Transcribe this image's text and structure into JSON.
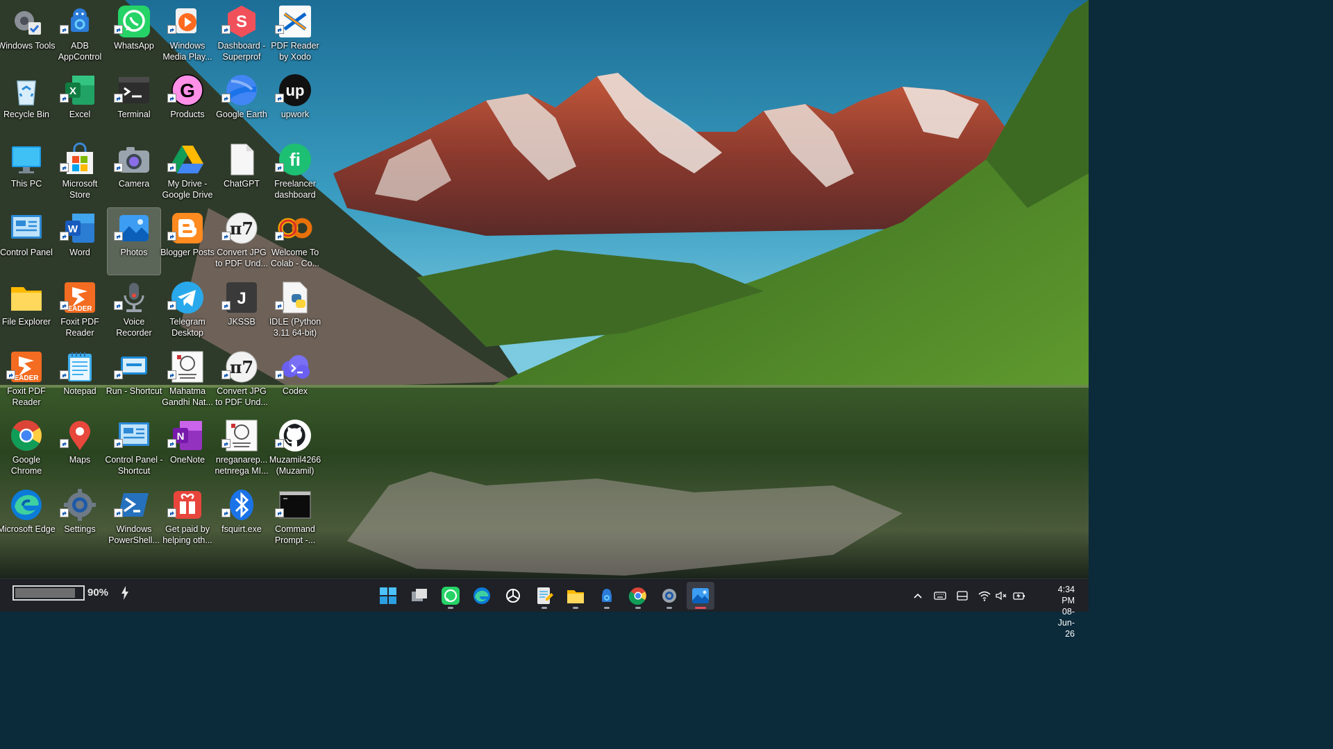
{
  "desktop": {
    "icons": [
      {
        "label": "Windows Tools",
        "icon": "gear-check-icon",
        "shortcut": false
      },
      {
        "label": "ADB AppControl",
        "icon": "android-robot-icon",
        "shortcut": true
      },
      {
        "label": "WhatsApp",
        "icon": "whatsapp-icon",
        "shortcut": true
      },
      {
        "label": "Windows Media Play...",
        "icon": "media-player-icon",
        "shortcut": true
      },
      {
        "label": "Dashboard - Superprof",
        "icon": "superprof-icon",
        "shortcut": true
      },
      {
        "label": "PDF Reader by Xodo",
        "icon": "xodo-icon",
        "shortcut": true
      },
      {
        "label": "Recycle Bin",
        "icon": "recycle-bin-icon",
        "shortcut": false
      },
      {
        "label": "Excel",
        "icon": "excel-icon",
        "shortcut": true
      },
      {
        "label": "Terminal",
        "icon": "terminal-icon",
        "shortcut": true
      },
      {
        "label": "Products",
        "icon": "gumroad-icon",
        "shortcut": true
      },
      {
        "label": "Google Earth",
        "icon": "google-earth-icon",
        "shortcut": true
      },
      {
        "label": "upwork",
        "icon": "upwork-icon",
        "shortcut": true
      },
      {
        "label": "This PC",
        "icon": "monitor-icon",
        "shortcut": false
      },
      {
        "label": "Microsoft Store",
        "icon": "store-bag-icon",
        "shortcut": true
      },
      {
        "label": "Camera",
        "icon": "camera-icon",
        "shortcut": true
      },
      {
        "label": "My Drive - Google Drive",
        "icon": "google-drive-icon",
        "shortcut": true
      },
      {
        "label": "ChatGPT",
        "icon": "blank-file-icon",
        "shortcut": false
      },
      {
        "label": "Freelancer dashboard",
        "icon": "fiverr-icon",
        "shortcut": true
      },
      {
        "label": "Control Panel",
        "icon": "control-panel-icon",
        "shortcut": false
      },
      {
        "label": "Word",
        "icon": "word-icon",
        "shortcut": true
      },
      {
        "label": "Photos",
        "icon": "photos-icon",
        "shortcut": true
      },
      {
        "label": "Blogger Posts",
        "icon": "blogger-icon",
        "shortcut": true
      },
      {
        "label": "Convert JPG to PDF Und...",
        "icon": "pi-seven-icon",
        "shortcut": true
      },
      {
        "label": "Welcome To Colab - Co...",
        "icon": "colab-icon",
        "shortcut": true
      },
      {
        "label": "File Explorer",
        "icon": "folder-icon",
        "shortcut": false
      },
      {
        "label": "Foxit PDF Reader",
        "icon": "foxit-icon",
        "shortcut": true
      },
      {
        "label": "Voice Recorder",
        "icon": "microphone-icon",
        "shortcut": true
      },
      {
        "label": "Telegram Desktop",
        "icon": "telegram-icon",
        "shortcut": true
      },
      {
        "label": "JKSSB",
        "icon": "letter-j-icon",
        "shortcut": true
      },
      {
        "label": "IDLE (Python 3.11 64-bit)",
        "icon": "python-file-icon",
        "shortcut": true
      },
      {
        "label": "Foxit PDF Reader",
        "icon": "foxit-icon",
        "shortcut": true
      },
      {
        "label": "Notepad",
        "icon": "notepad-icon",
        "shortcut": true
      },
      {
        "label": "Run - Shortcut",
        "icon": "run-icon",
        "shortcut": true
      },
      {
        "label": "Mahatma Gandhi Nat...",
        "icon": "emblem-icon",
        "shortcut": true
      },
      {
        "label": "Convert JPG to PDF Und...",
        "icon": "pi-seven-icon",
        "shortcut": true
      },
      {
        "label": "Codex",
        "icon": "codex-cloud-icon",
        "shortcut": true
      },
      {
        "label": "Google Chrome",
        "icon": "chrome-icon",
        "shortcut": false
      },
      {
        "label": "Maps",
        "icon": "maps-pin-icon",
        "shortcut": true
      },
      {
        "label": "Control Panel - Shortcut",
        "icon": "control-panel-icon",
        "shortcut": true
      },
      {
        "label": "OneNote",
        "icon": "onenote-icon",
        "shortcut": true
      },
      {
        "label": "nreganarep... netnrega MI...",
        "icon": "emblem-icon",
        "shortcut": true
      },
      {
        "label": "Muzamil4266 (Muzamil)",
        "icon": "github-icon",
        "shortcut": true
      },
      {
        "label": "Microsoft Edge",
        "icon": "edge-icon",
        "shortcut": false
      },
      {
        "label": "Settings",
        "icon": "settings-gear-icon",
        "shortcut": true
      },
      {
        "label": "Windows PowerShell...",
        "icon": "powershell-icon",
        "shortcut": true
      },
      {
        "label": "Get paid by helping oth...",
        "icon": "gift-box-icon",
        "shortcut": true
      },
      {
        "label": "fsquirt.exe",
        "icon": "bluetooth-icon",
        "shortcut": true
      },
      {
        "label": "Command Prompt -...",
        "icon": "cmd-icon",
        "shortcut": true
      }
    ],
    "selected_label": "Photos"
  },
  "taskbar": {
    "battery": {
      "percent_text": "90%",
      "level": 0.9
    },
    "apps": [
      {
        "name": "start-button",
        "running": false
      },
      {
        "name": "task-view-button",
        "running": false
      },
      {
        "name": "whatsapp-taskbar",
        "running": true
      },
      {
        "name": "edge-taskbar",
        "running": false
      },
      {
        "name": "chatgpt-taskbar",
        "running": false
      },
      {
        "name": "notepad-taskbar",
        "running": true
      },
      {
        "name": "file-explorer-taskbar",
        "running": true
      },
      {
        "name": "adb-taskbar",
        "running": true
      },
      {
        "name": "chrome-taskbar",
        "running": true
      },
      {
        "name": "settings-taskbar",
        "running": true
      },
      {
        "name": "photos-taskbar",
        "running": true,
        "active": true
      }
    ],
    "clock": {
      "time": "4:34 PM",
      "date": "08-Jun-26"
    }
  },
  "colors": {
    "taskbar": "#1f2127",
    "accent": "#e34a5c",
    "label": "#ffffff"
  }
}
